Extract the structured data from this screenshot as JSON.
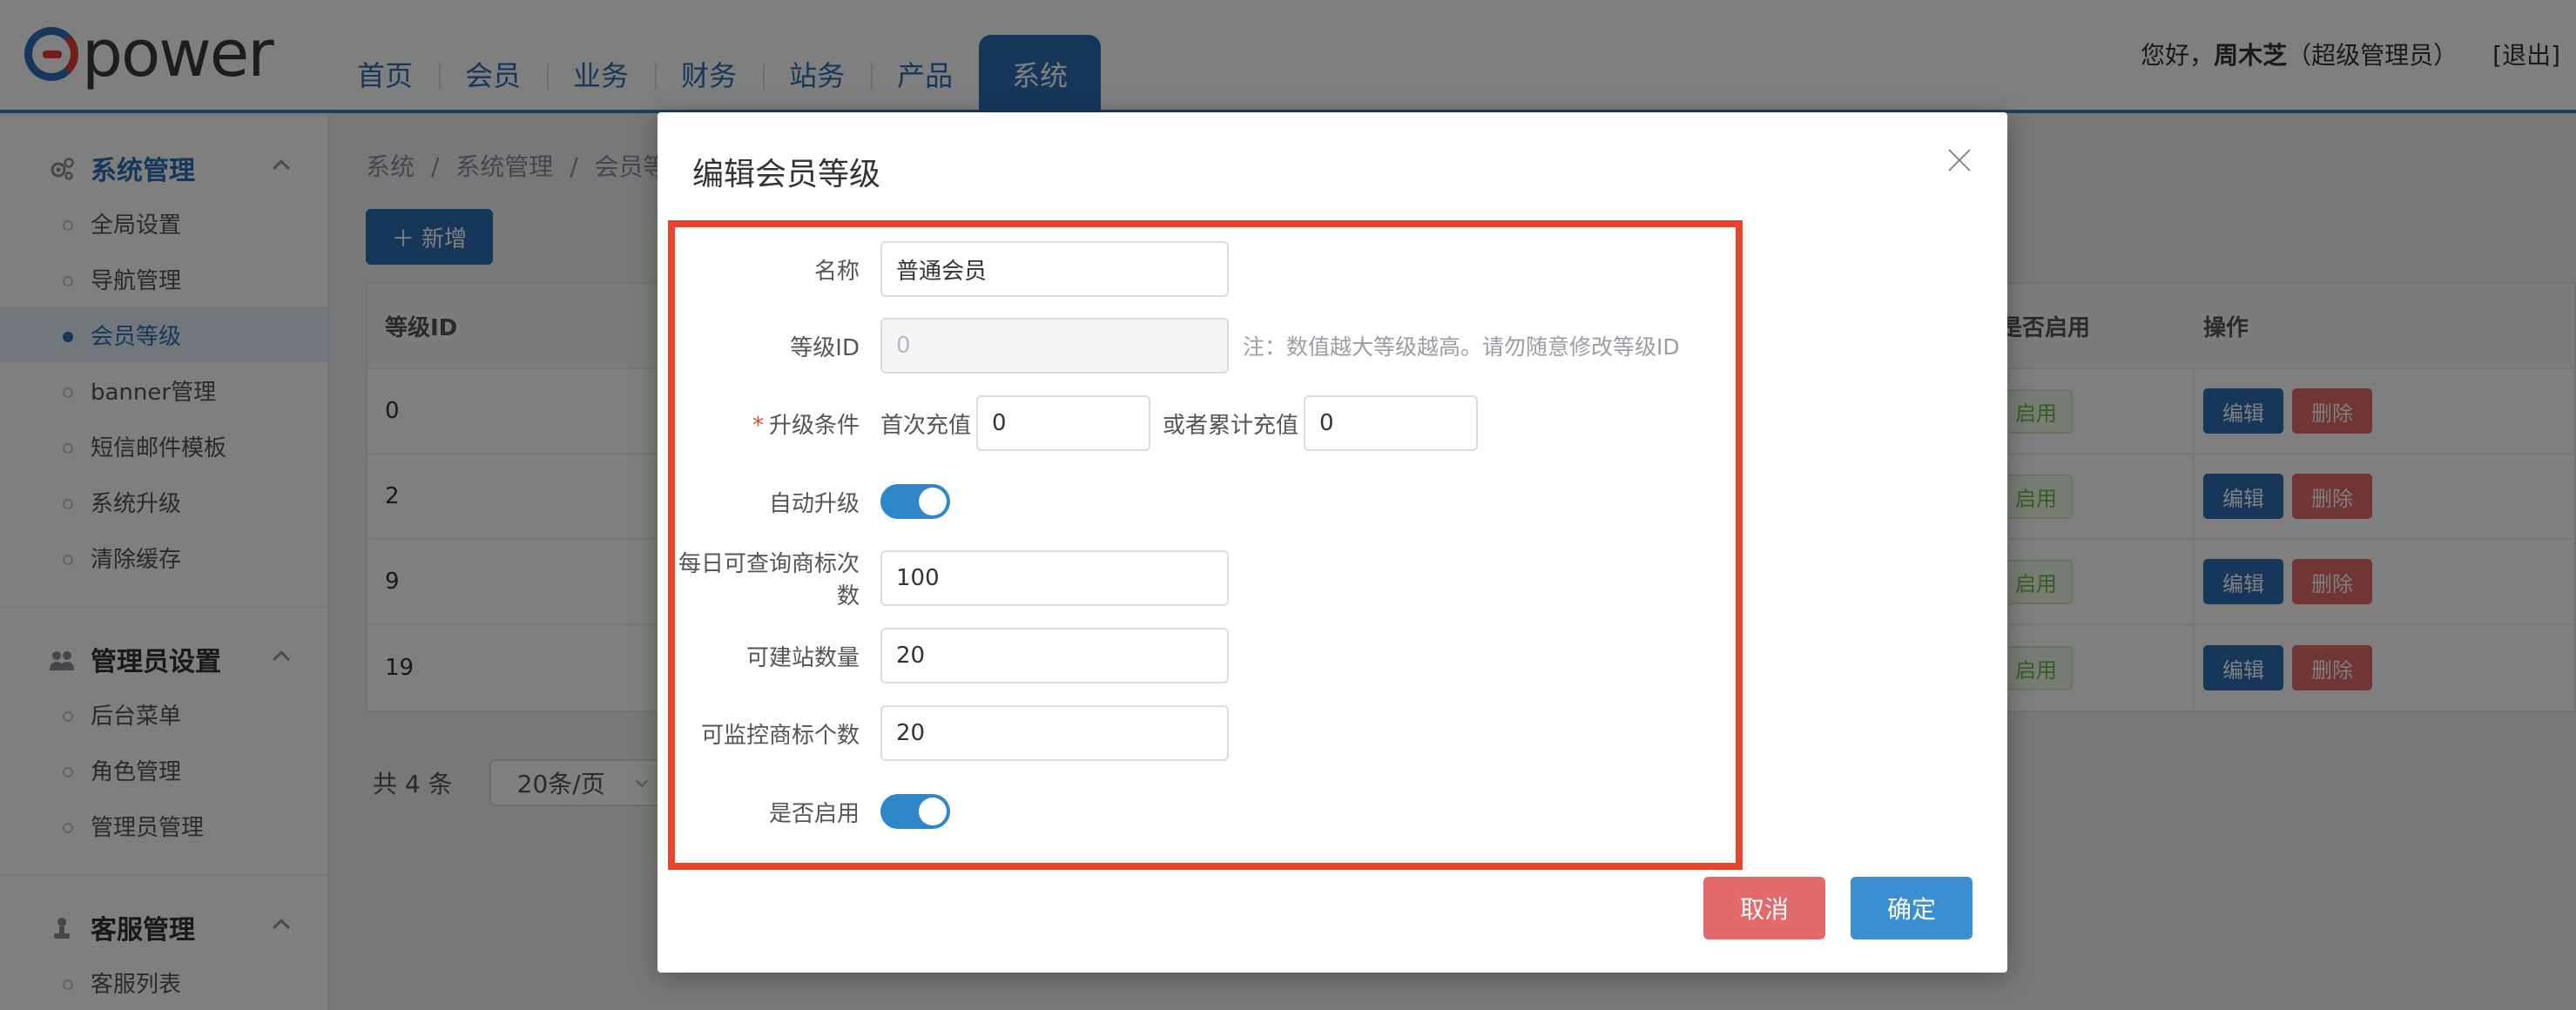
{
  "app": {
    "logo_text": "power"
  },
  "nav": {
    "items": [
      "首页",
      "会员",
      "业务",
      "财务",
      "站务",
      "产品",
      "系统"
    ],
    "active": "系统"
  },
  "user": {
    "greeting": "您好，",
    "name": "周木芝",
    "role": "（超级管理员）",
    "logout": "[退出]"
  },
  "sidebar": {
    "groups": [
      {
        "title": "系统管理",
        "items": [
          "全局设置",
          "导航管理",
          "会员等级",
          "banner管理",
          "短信邮件模板",
          "系统升级",
          "清除缓存"
        ]
      },
      {
        "title": "管理员设置",
        "items": [
          "后台菜单",
          "角色管理",
          "管理员管理"
        ]
      },
      {
        "title": "客服管理",
        "items": [
          "客服列表"
        ]
      }
    ],
    "active_item": "会员等级"
  },
  "breadcrumb": [
    "系统",
    "/",
    "系统管理",
    "/",
    "会员等"
  ],
  "toolbar": {
    "add_label": "新增"
  },
  "table": {
    "headers": {
      "id": "等级ID",
      "enabled": "是否启用",
      "ops": "操作"
    },
    "rows": [
      {
        "id": "0",
        "enabled": "启用"
      },
      {
        "id": "2",
        "enabled": "启用"
      },
      {
        "id": "9",
        "enabled": "启用"
      },
      {
        "id": "19",
        "enabled": "启用"
      }
    ],
    "edit_label": "编辑",
    "delete_label": "删除"
  },
  "pager": {
    "total": "共 4 条",
    "page_size": "20条/页"
  },
  "modal": {
    "title": "编辑会员等级",
    "fields": {
      "name": {
        "label": "名称",
        "value": "普通会员"
      },
      "level_id": {
        "label": "等级ID",
        "value": "0",
        "hint": "注：数值越大等级越高。请勿随意修改等级ID"
      },
      "upgrade": {
        "label": "升级条件",
        "first_label": "首次充值",
        "first_value": "0",
        "total_label": "或者累计充值",
        "total_value": "0"
      },
      "auto_upgrade": {
        "label": "自动升级",
        "on": true
      },
      "daily_query": {
        "label": "每日可查询商标次数",
        "value": "100"
      },
      "sites": {
        "label": "可建站数量",
        "value": "20"
      },
      "monitor": {
        "label": "可监控商标个数",
        "value": "20"
      },
      "enabled": {
        "label": "是否启用",
        "on": true
      }
    },
    "cancel_label": "取消",
    "ok_label": "确定"
  },
  "colors": {
    "primary": "#2f6fb4",
    "danger": "#e36a6a",
    "highlight": "#e8442b",
    "toggle": "#2f86c9"
  }
}
